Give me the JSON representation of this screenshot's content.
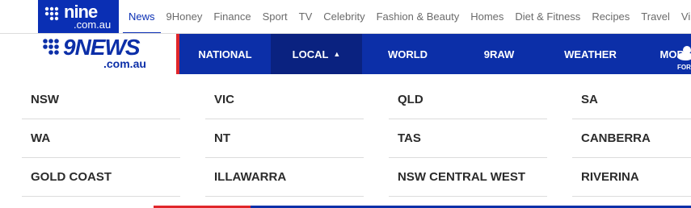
{
  "network": {
    "logo_word": "nine",
    "logo_sub": ".com.au",
    "links": [
      "News",
      "9Honey",
      "Finance",
      "Sport",
      "TV",
      "Celebrity",
      "Fashion & Beauty",
      "Homes",
      "Diet & Fitness",
      "Recipes",
      "Travel",
      "Viral"
    ],
    "active": "News"
  },
  "brand": {
    "word": "9NEWS",
    "sub": ".com.au"
  },
  "nav": {
    "items": [
      {
        "label": "NATIONAL"
      },
      {
        "label": "LOCAL",
        "active": true,
        "chevron": "chevron-up-icon"
      },
      {
        "label": "WORLD"
      },
      {
        "label": "9RAW"
      },
      {
        "label": "WEATHER"
      },
      {
        "label": "MORE",
        "chevron": "chevron-down-icon"
      }
    ],
    "weather_label": "FOR"
  },
  "dropdown": {
    "regions": [
      "NSW",
      "VIC",
      "QLD",
      "SA",
      "WA",
      "NT",
      "TAS",
      "CANBERRA",
      "GOLD COAST",
      "ILLAWARRA",
      "NSW CENTRAL WEST",
      "RIVERINA"
    ]
  },
  "colors": {
    "brand_blue": "#0c2fa8",
    "active_blue": "#0a2280",
    "accent_red": "#e0262a"
  }
}
